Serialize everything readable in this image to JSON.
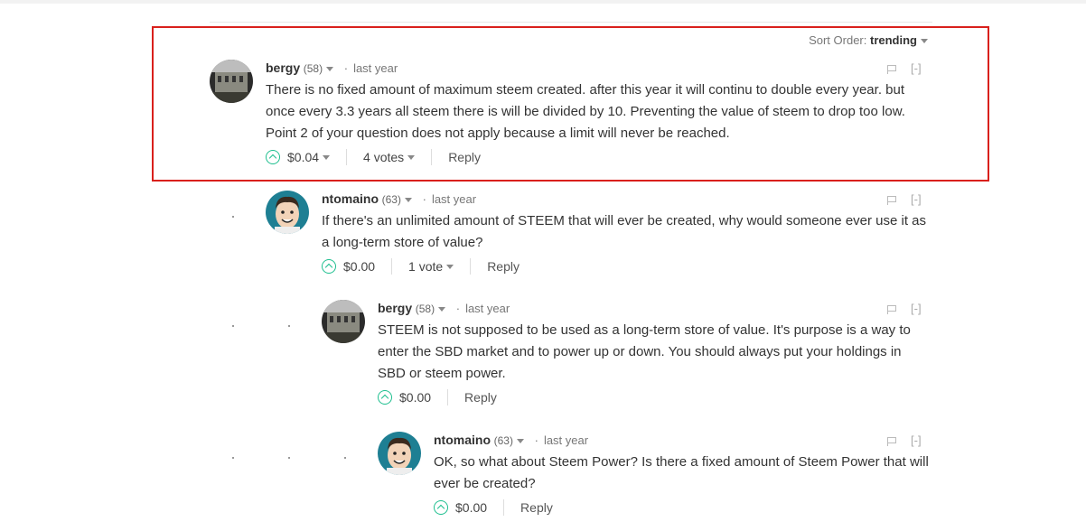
{
  "sort": {
    "label": "Sort Order:",
    "value": "trending"
  },
  "comments": [
    {
      "author": "bergy",
      "rep": "(58)",
      "time": "last year",
      "text": "There is no fixed amount of maximum steem created. after this year it will continu to double every year. but once every 3.3 years all steem there is will be divided by 10. Preventing the value of steem to drop too low. Point 2 of your question does not apply because a limit will never be reached.",
      "payout": "$0.04",
      "votes": "4 votes",
      "reply": "Reply",
      "collapse": "[-]"
    },
    {
      "author": "ntomaino",
      "rep": "(63)",
      "time": "last year",
      "text": "If there's an unlimited amount of STEEM that will ever be created, why would someone ever use it as a long-term store of value?",
      "payout": "$0.00",
      "votes": "1 vote",
      "reply": "Reply",
      "collapse": "[-]"
    },
    {
      "author": "bergy",
      "rep": "(58)",
      "time": "last year",
      "text": "STEEM is not supposed to be used as a long-term store of value. It's purpose is a way to enter the SBD market and to power up or down. You should always put your holdings in SBD or steem power.",
      "payout": "$0.00",
      "reply": "Reply",
      "collapse": "[-]"
    },
    {
      "author": "ntomaino",
      "rep": "(63)",
      "time": "last year",
      "text": "OK, so what about Steem Power? Is there a fixed amount of Steem Power that will ever be created?",
      "payout": "$0.00",
      "reply": "Reply",
      "collapse": "[-]"
    }
  ]
}
